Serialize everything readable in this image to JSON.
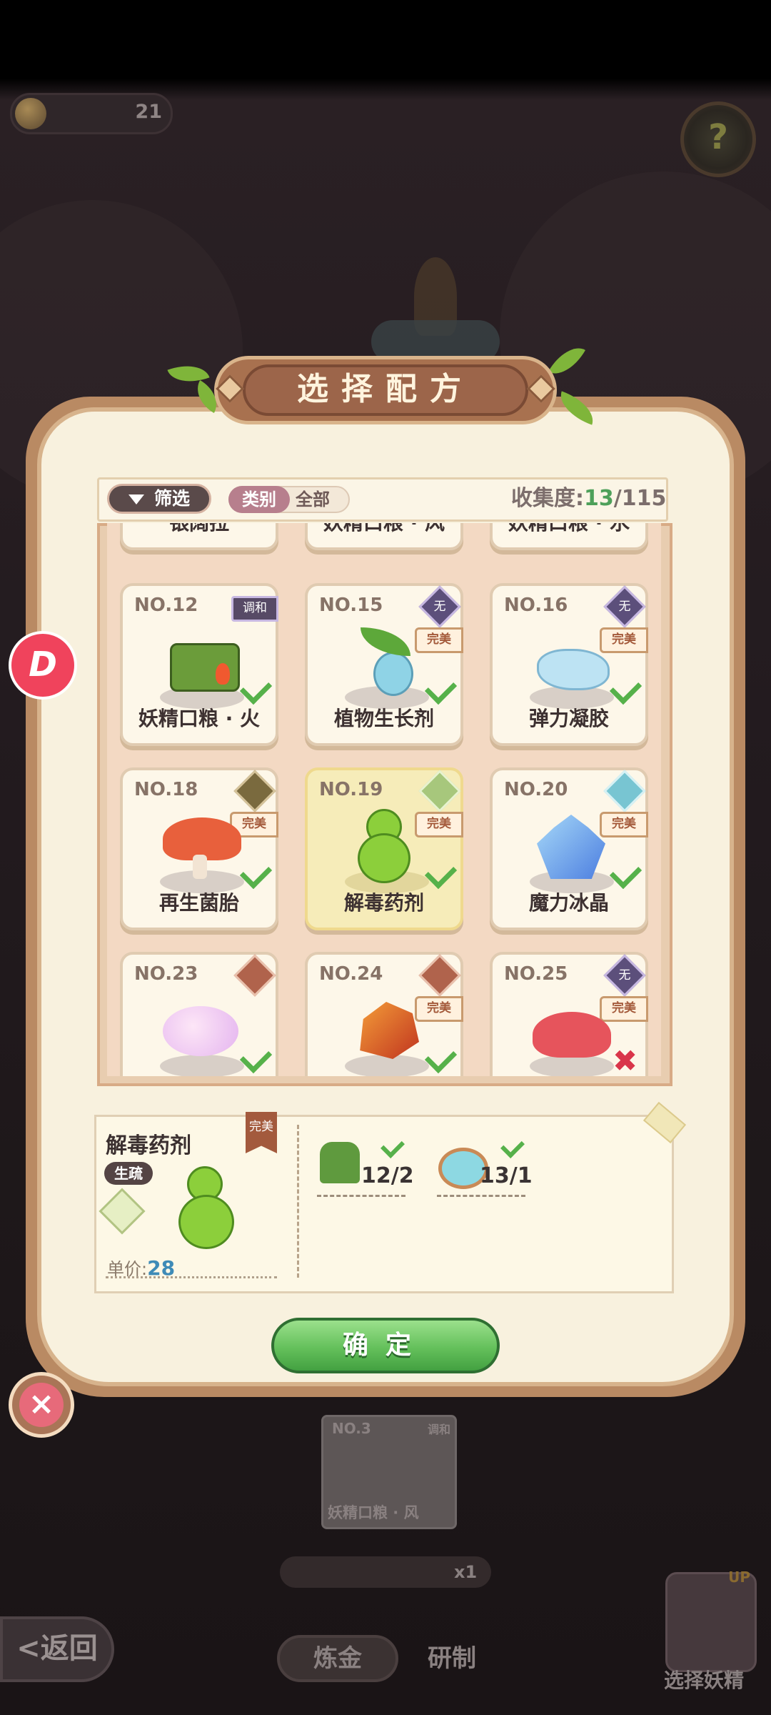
{
  "hud": {
    "coins": "21",
    "help_icon": "question-mark"
  },
  "title": "选择配方",
  "filter": {
    "button_label": "筛选",
    "category_label": "类别",
    "category_value": "全部"
  },
  "collection": {
    "label": "收集度:",
    "collected": "13",
    "total": "/115"
  },
  "top_row_names": [
    "银阔拉",
    "妖精口粮 · 风",
    "妖精口粮 · 水"
  ],
  "cards": [
    {
      "no": "NO.12",
      "name": "妖精口粮 · 火",
      "tag": "调和",
      "status": "check"
    },
    {
      "no": "NO.15",
      "name": "植物生长剂",
      "type": "无",
      "badge": "完美",
      "status": "check"
    },
    {
      "no": "NO.16",
      "name": "弹力凝胶",
      "type": "无",
      "badge": "完美",
      "status": "check"
    },
    {
      "no": "NO.18",
      "name": "再生菌胎",
      "badge": "完美",
      "status": "check"
    },
    {
      "no": "NO.19",
      "name": "解毒药剂",
      "badge": "完美",
      "status": "check",
      "selected": true
    },
    {
      "no": "NO.20",
      "name": "魔力冰晶",
      "badge": "完美",
      "status": "check"
    },
    {
      "no": "NO.23",
      "name": "",
      "status": "check"
    },
    {
      "no": "NO.24",
      "name": "",
      "badge": "完美",
      "status": "check"
    },
    {
      "no": "NO.25",
      "name": "",
      "type": "无",
      "badge": "完美",
      "status": "cross"
    }
  ],
  "detail": {
    "name": "解毒药剂",
    "type": "生疏",
    "perfect": "完美",
    "price_label": "单价:",
    "price": "28",
    "ingredients": [
      {
        "count": "12/2"
      },
      {
        "count": "13/1"
      }
    ]
  },
  "confirm_label": "确定",
  "close_icon": "×",
  "float_icon": "D",
  "background_ui": {
    "back_label": "返回",
    "under_card_no": "NO.3",
    "under_card_tag": "调和",
    "under_card_name": "妖精口粮 · 风",
    "multiplier": "x1",
    "tab_alchemy": "炼金",
    "tab_research": "研制",
    "select_fairy": "选择妖精",
    "up_badge": "UP"
  }
}
